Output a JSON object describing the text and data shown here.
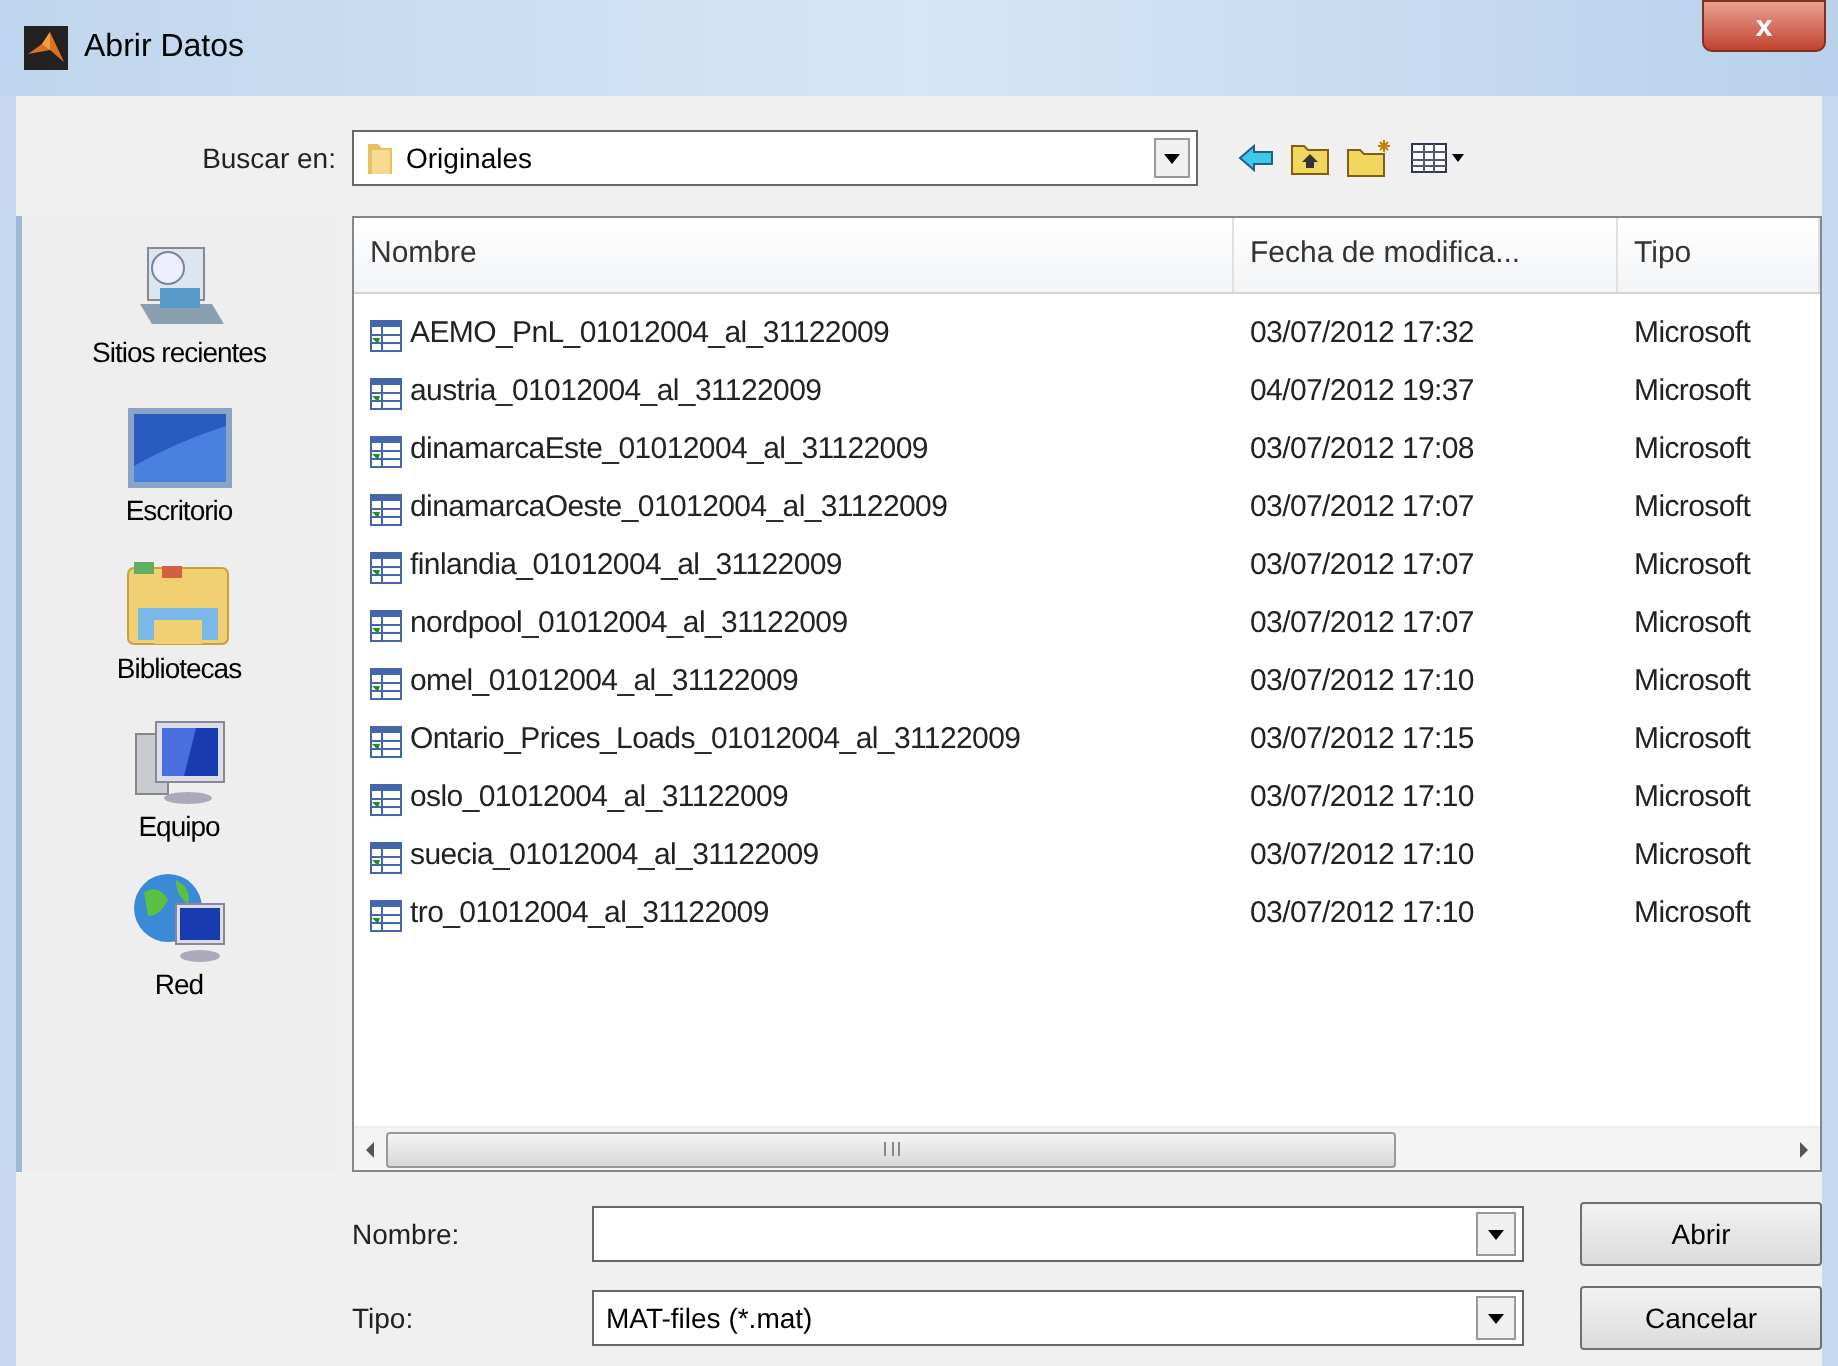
{
  "window": {
    "title": "Abrir Datos",
    "close": "x"
  },
  "look_in": {
    "label": "Buscar en:",
    "value": "Originales"
  },
  "places": [
    {
      "label": "Sitios recientes",
      "kind": "recent"
    },
    {
      "label": "Escritorio",
      "kind": "desktop"
    },
    {
      "label": "Bibliotecas",
      "kind": "libraries"
    },
    {
      "label": "Equipo",
      "kind": "computer"
    },
    {
      "label": "Red",
      "kind": "network"
    }
  ],
  "table": {
    "columns": [
      "Nombre",
      "Fecha de modifica...",
      "Tipo"
    ],
    "rows": [
      [
        "AEMO_PnL_01012004_al_31122009",
        "03/07/2012 17:32",
        "Microsoft"
      ],
      [
        "austria_01012004_al_31122009",
        "04/07/2012 19:37",
        "Microsoft"
      ],
      [
        "dinamarcaEste_01012004_al_31122009",
        "03/07/2012 17:08",
        "Microsoft"
      ],
      [
        "dinamarcaOeste_01012004_al_31122009",
        "03/07/2012 17:07",
        "Microsoft"
      ],
      [
        "finlandia_01012004_al_31122009",
        "03/07/2012 17:07",
        "Microsoft"
      ],
      [
        "nordpool_01012004_al_31122009",
        "03/07/2012 17:07",
        "Microsoft"
      ],
      [
        "omel_01012004_al_31122009",
        "03/07/2012 17:10",
        "Microsoft"
      ],
      [
        "Ontario_Prices_Loads_01012004_al_31122009",
        "03/07/2012 17:15",
        "Microsoft"
      ],
      [
        "oslo_01012004_al_31122009",
        "03/07/2012 17:10",
        "Microsoft"
      ],
      [
        "suecia_01012004_al_31122009",
        "03/07/2012 17:10",
        "Microsoft"
      ],
      [
        "tro_01012004_al_31122009",
        "03/07/2012 17:10",
        "Microsoft"
      ]
    ]
  },
  "file_name": {
    "label": "Nombre:"
  },
  "file_type": {
    "label": "Tipo:",
    "value": "MAT-files (*.mat)"
  },
  "buttons": [
    "Abrir",
    "Cancelar"
  ]
}
